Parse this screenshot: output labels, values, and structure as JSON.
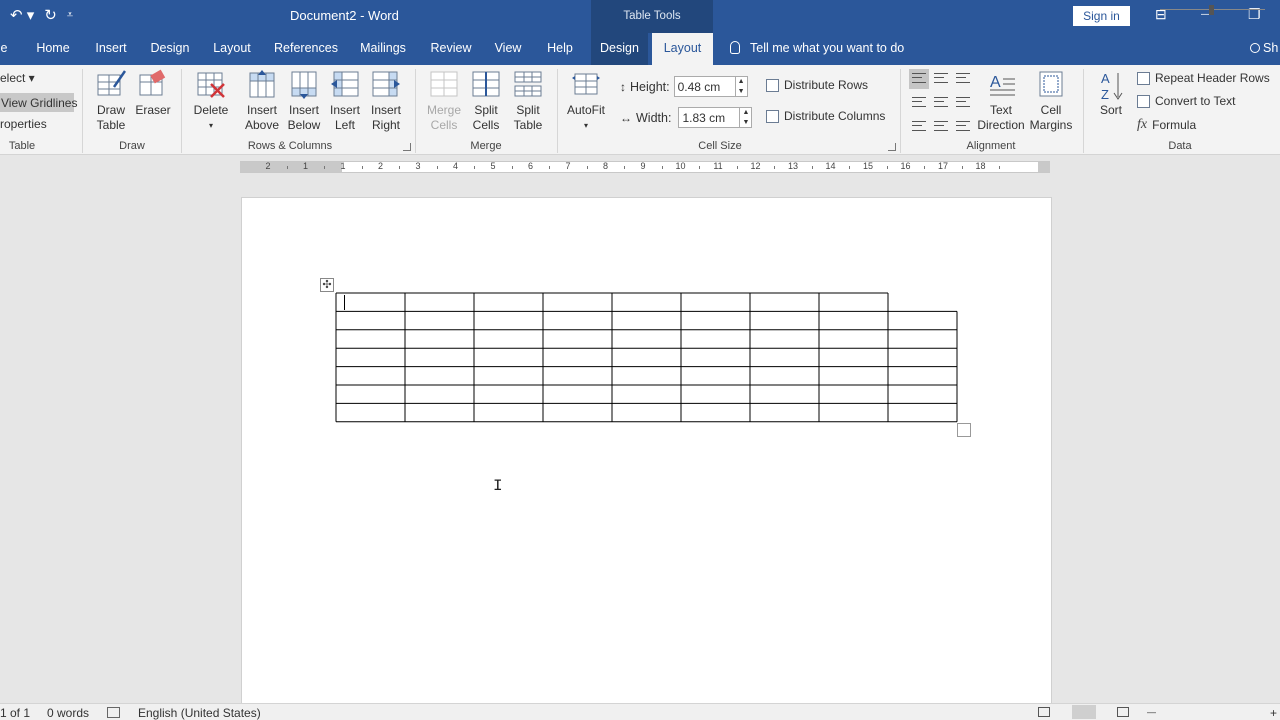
{
  "titlebar": {
    "document_title": "Document2 - Word",
    "contextual_header": "Table Tools",
    "sign_in": "Sign in",
    "undo_glyph": "↶ ▾",
    "redo_glyph": "↻",
    "qat_glyph": "⩡",
    "display_options_glyph": "⊟",
    "minimize_glyph": "—",
    "restore_glyph": "❐"
  },
  "tabs": [
    {
      "label": "e"
    },
    {
      "label": "Home"
    },
    {
      "label": "Insert"
    },
    {
      "label": "Design"
    },
    {
      "label": "Layout"
    },
    {
      "label": "References"
    },
    {
      "label": "Mailings"
    },
    {
      "label": "Review"
    },
    {
      "label": "View"
    },
    {
      "label": "Help"
    },
    {
      "label": "Design"
    },
    {
      "label": "Layout"
    }
  ],
  "tell_me": "Tell me what you want to do",
  "share": "Sh",
  "ribbon": {
    "table_group": {
      "label": "Table",
      "select": "elect ▾",
      "view_gridlines": "View Gridlines",
      "properties": "roperties"
    },
    "draw_group": {
      "label": "Draw",
      "draw_table_1": "Draw",
      "draw_table_2": "Table",
      "eraser": "Eraser"
    },
    "rows_columns_group": {
      "label": "Rows & Columns",
      "delete": "Delete",
      "delete_caret": "▾",
      "insert_above_1": "Insert",
      "insert_above_2": "Above",
      "insert_below_1": "Insert",
      "insert_below_2": "Below",
      "insert_left_1": "Insert",
      "insert_left_2": "Left",
      "insert_right_1": "Insert",
      "insert_right_2": "Right"
    },
    "merge_group": {
      "label": "Merge",
      "merge_cells_1": "Merge",
      "merge_cells_2": "Cells",
      "split_cells_1": "Split",
      "split_cells_2": "Cells",
      "split_table_1": "Split",
      "split_table_2": "Table"
    },
    "cell_size_group": {
      "label": "Cell Size",
      "autofit": "AutoFit",
      "autofit_caret": "▾",
      "height_label": "Height:",
      "height_value": "0.48 cm",
      "width_label": "Width:",
      "width_value": "1.83 cm",
      "distribute_rows": "Distribute Rows",
      "distribute_columns": "Distribute Columns"
    },
    "alignment_group": {
      "label": "Alignment",
      "text_direction_1": "Text",
      "text_direction_2": "Direction",
      "cell_margins_1": "Cell",
      "cell_margins_2": "Margins"
    },
    "data_group": {
      "label": "Data",
      "sort": "Sort",
      "repeat_header_rows": "Repeat Header Rows",
      "convert_to_text": "Convert to Text",
      "formula": "Formula",
      "formula_glyph": "fx"
    }
  },
  "ruler": {
    "numbers": [
      "2",
      "1",
      "1",
      "2",
      "3",
      "4",
      "5",
      "6",
      "7",
      "8",
      "9",
      "10",
      "11",
      "12",
      "13",
      "14",
      "15",
      "16",
      "17",
      "18"
    ]
  },
  "table": {
    "rows": 7,
    "columns": 9,
    "first_row_columns": 8
  },
  "statusbar": {
    "page": "1 of 1",
    "words": "0 words",
    "language": "English (United States)",
    "zoom_out": "—",
    "zoom_in": "+"
  },
  "icons": {
    "move_handle": "✣",
    "ibeam": "I"
  },
  "colors": {
    "brand_blue": "#2b579a",
    "contextual_blue": "#22477c",
    "ribbon_bg": "#f3f3f3",
    "canvas_bg": "#e6e6e6"
  }
}
